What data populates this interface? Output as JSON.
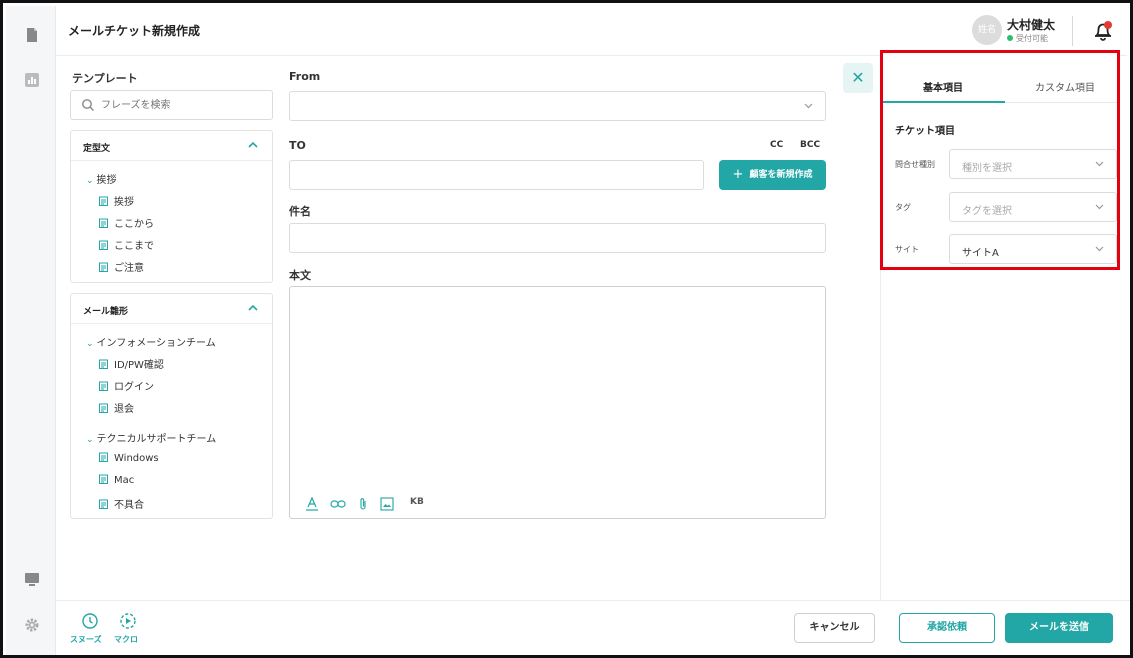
{
  "header": {
    "title": "メールチケット新規作成",
    "avatar_text": "姓名",
    "user_name": "大村健太",
    "user_status": "受付可能"
  },
  "templates": {
    "heading": "テンプレート",
    "search_placeholder": "フレーズを検索",
    "fixed_phrases": {
      "title": "定型文",
      "group": "挨拶",
      "items": [
        "挨拶",
        "ここから",
        "ここまで",
        "ご注意"
      ]
    },
    "mail_templates": {
      "title": "メール雛形",
      "groups": [
        {
          "name": "インフォメーションチーム",
          "items": [
            "ID/PW確認",
            "ログイン",
            "退会"
          ]
        },
        {
          "name": "テクニカルサポートチーム",
          "items": [
            "Windows",
            "Mac",
            "不具合"
          ]
        }
      ]
    }
  },
  "form": {
    "from_label": "From",
    "to_label": "TO",
    "cc_label": "CC",
    "bcc_label": "BCC",
    "new_customer_button": "顧客を新規作成",
    "subject_label": "件名",
    "body_label": "本文",
    "toolbar_kb": "KB"
  },
  "right_panel": {
    "tabs": [
      "基本項目",
      "カスタム項目"
    ],
    "section_title": "チケット項目",
    "fields": [
      {
        "label": "問合せ種別",
        "value": "種別を選択",
        "selected": false
      },
      {
        "label": "タグ",
        "value": "タグを選択",
        "selected": false
      },
      {
        "label": "サイト",
        "value": "サイトA",
        "selected": true
      }
    ]
  },
  "footer": {
    "snooze_label": "スヌーズ",
    "macro_label": "マクロ",
    "cancel_button": "キャンセル",
    "approval_button": "承認依頼",
    "send_button": "メールを送信"
  },
  "colors": {
    "accent": "#23a6a6",
    "highlight_border": "#e3000f",
    "status_green": "#2bbf6a",
    "notification": "#e53935"
  }
}
